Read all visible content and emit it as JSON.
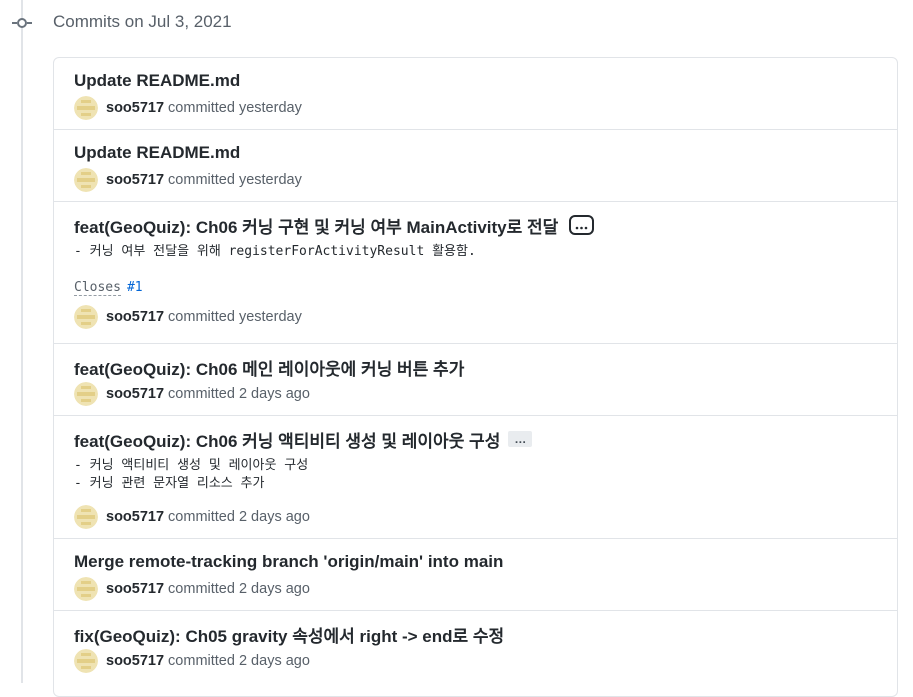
{
  "date_header": "Commits on Jul 3, 2021",
  "commits": [
    {
      "title": "Update README.md",
      "author": "soo5717",
      "action": "committed",
      "time": "yesterday"
    },
    {
      "title": "Update README.md",
      "author": "soo5717",
      "action": "committed",
      "time": "yesterday"
    },
    {
      "title": "feat(GeoQuiz): Ch06 커닝 구현 및 커닝 여부 MainActivity로 전달",
      "body": "- 커닝 여부 전달을 위해 registerForActivityResult 활용함.",
      "closes_label": "Closes",
      "closes_ref": "#1",
      "author": "soo5717",
      "action": "committed",
      "time": "yesterday"
    },
    {
      "title": "feat(GeoQuiz): Ch06 메인 레이아웃에 커닝 버튼 추가",
      "author": "soo5717",
      "action": "committed",
      "time": "2 days ago"
    },
    {
      "title": "feat(GeoQuiz): Ch06 커닝 액티비티 생성 및 레이아웃 구성",
      "ellipsis": "…",
      "body": "- 커닝 액티비티 생성 및 레이아웃 구성\n- 커닝 관련 문자열 리소스 추가",
      "author": "soo5717",
      "action": "committed",
      "time": "2 days ago"
    },
    {
      "title": "Merge remote-tracking branch 'origin/main' into main",
      "author": "soo5717",
      "action": "committed",
      "time": "2 days ago"
    },
    {
      "title": "fix(GeoQuiz): Ch05 gravity 속성에서 right -> end로 수정",
      "author": "soo5717",
      "action": "committed",
      "time": "2 days ago"
    }
  ]
}
